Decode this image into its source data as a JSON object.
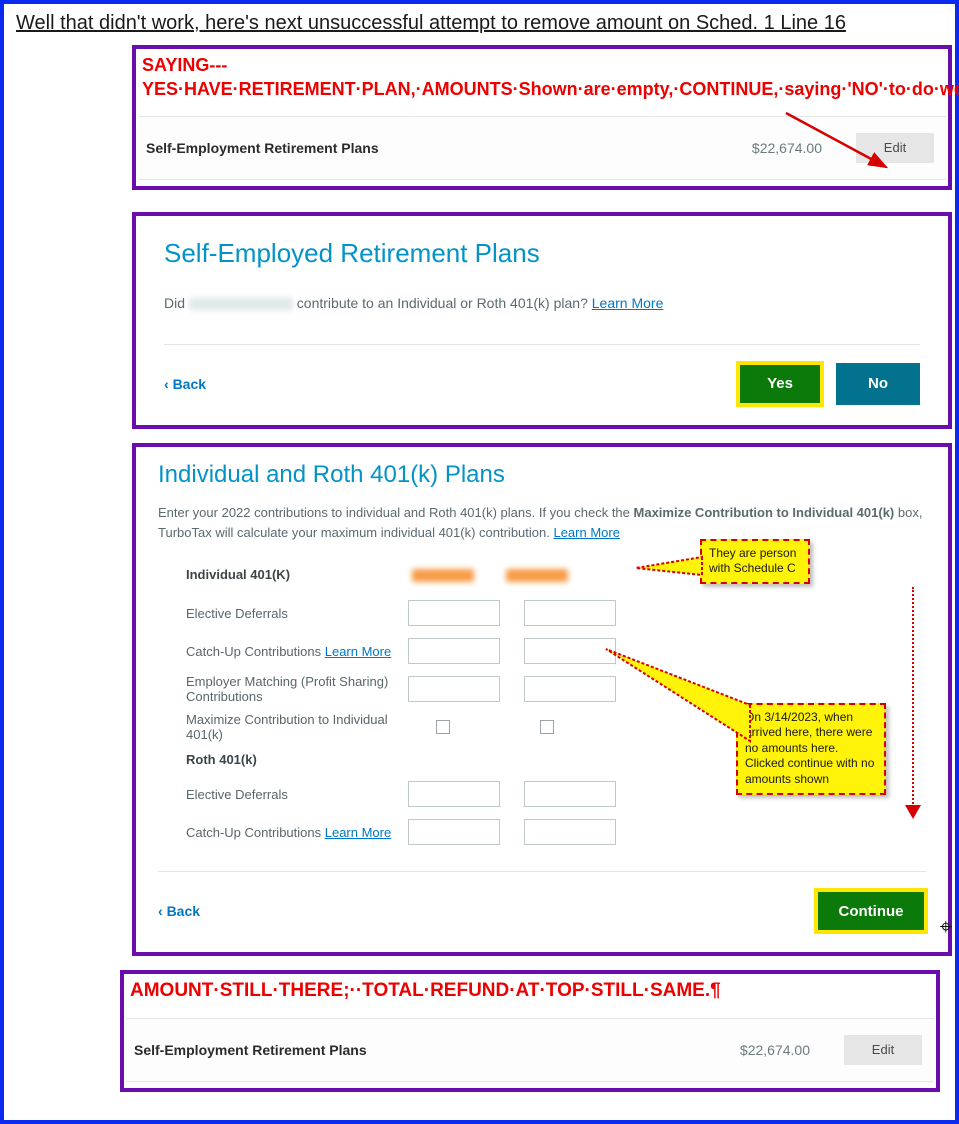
{
  "heading": "Well that didn't work, here's next unsuccessful attempt to remove amount on Sched. 1 Line 16",
  "box1": {
    "note": "SAYING---YES·HAVE·RETIREMENT·PLAN,·AMOUNTS·Shown·are·empty,·CONTINUE,·saying·'NO'·to·do·we·plan·to·contribute,·yet·DEDUCTION·still·there.¶",
    "row_label": "Self-Employment Retirement Plans",
    "amount": "$22,674.00",
    "edit": "Edit"
  },
  "pilcrow": "¶",
  "box2": {
    "title": "Self-Employed Retirement Plans",
    "q_prefix": "Did ",
    "q_suffix": " contribute to an Individual or Roth 401(k) plan? ",
    "learn": "Learn More",
    "back": "Back",
    "yes": "Yes",
    "no": "No"
  },
  "box3": {
    "title": "Individual and Roth 401(k) Plans",
    "intro_a": "Enter your 2022 contributions to individual and Roth 401(k) plans. If you check the ",
    "intro_bold": "Maximize Contribution to Individual 401(k)",
    "intro_b": " box, TurboTax will calculate your maximum individual 401(k) contribution. ",
    "learn": "Learn More",
    "sec1": "Individual 401(K)",
    "r1": "Elective Deferrals",
    "r2a": "Catch-Up Contributions ",
    "r3": "Employer Matching (Profit Sharing) Contributions",
    "r4": "Maximize Contribution to Individual 401(k)",
    "sec2": "Roth 401(k)",
    "r5": "Elective Deferrals",
    "r6a": "Catch-Up Contributions ",
    "back": "Back",
    "continue": "Continue",
    "callout1": "They are person with Schedule C",
    "callout2": "On 3/14/2023, when arrived here, there were no amounts here. Clicked continue with no amounts shown"
  },
  "box4": {
    "note": "AMOUNT·STILL·THERE;··TOTAL·REFUND·AT·TOP·STILL·SAME.¶",
    "row_label": "Self-Employment Retirement Plans",
    "amount": "$22,674.00",
    "edit": "Edit"
  }
}
